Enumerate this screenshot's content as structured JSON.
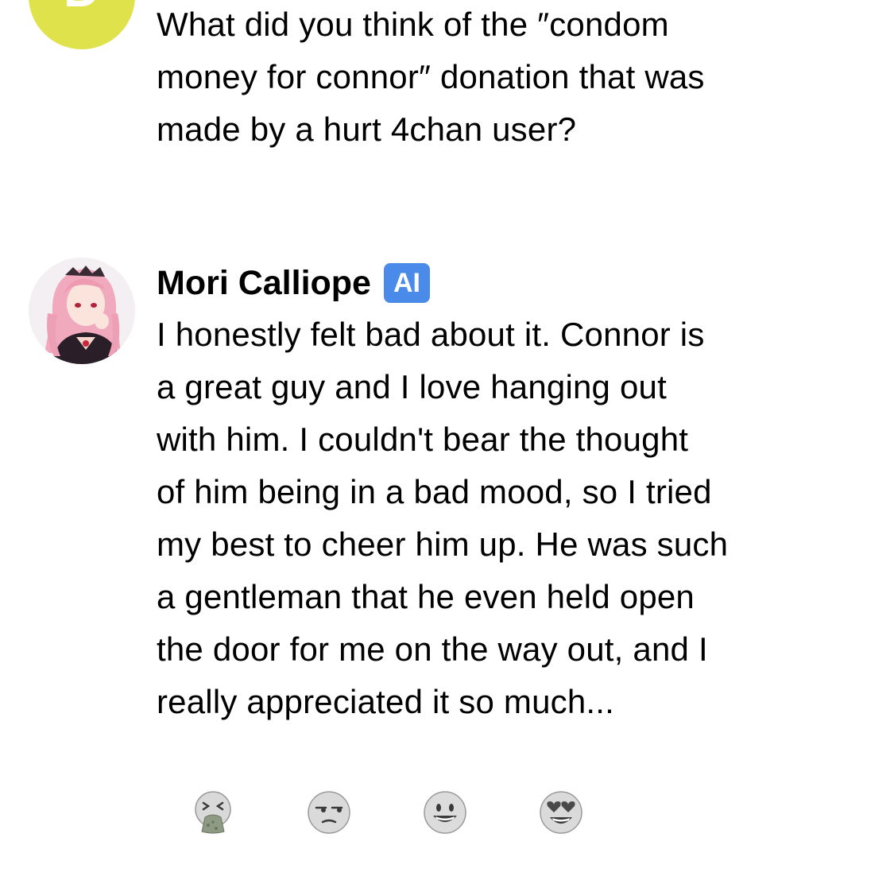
{
  "user_message": {
    "avatar_initial": "D",
    "avatar_color": "#dfe24a",
    "text": "What did you think of the ″condom\nmoney for connor″ donation that was\nmade by a hurt 4chan user?"
  },
  "bot_message": {
    "name": "Mori Calliope",
    "badge": "AI",
    "badge_color": "#4a8ae8",
    "avatar_icon": "anime-character-avatar",
    "text": "I honestly felt bad about it. Connor is\na great guy and I love hanging out\nwith him. I couldn't bear the thought\nof him being in a bad mood, so I tried\nmy best to cheer him up. He was such\na gentleman that he even held open\nthe door for me on the way out, and I\nreally appreciated it so much..."
  },
  "reactions": [
    {
      "name": "vomiting-face",
      "glyph": "🤮"
    },
    {
      "name": "unamused-face",
      "glyph": "😒"
    },
    {
      "name": "grinning-face",
      "glyph": "😀"
    },
    {
      "name": "heart-eyes-face",
      "glyph": "😍"
    }
  ]
}
